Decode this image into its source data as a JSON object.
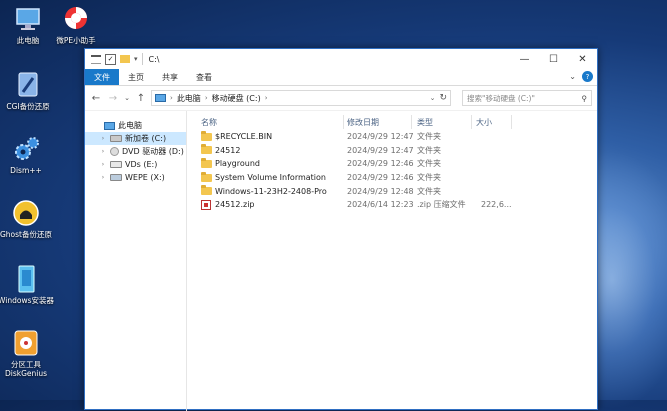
{
  "desktop": {
    "icons": [
      {
        "label": "此电脑"
      },
      {
        "label": "微PE小助手"
      },
      {
        "label": "CGI备份还原"
      },
      {
        "label": "Dism++"
      },
      {
        "label": "Ghost备份还原"
      },
      {
        "label": "Windows安装器"
      },
      {
        "label": "分区工具DiskGenius"
      }
    ]
  },
  "window": {
    "title": "C:\\",
    "controls": {
      "minimize": "—",
      "maximize": "☐",
      "close": "✕"
    },
    "ribbon_tabs": [
      "文件",
      "主页",
      "共享",
      "查看"
    ],
    "address": {
      "segments": [
        "此电脑",
        "移动硬盘 (C:)"
      ]
    },
    "search": {
      "placeholder": "搜索\"移动硬盘 (C:)\""
    },
    "nav": [
      {
        "label": "此电脑",
        "selected": false
      },
      {
        "label": "新加卷 (C:)",
        "selected": true
      },
      {
        "label": "DVD 驱动器 (D:) ",
        "selected": false
      },
      {
        "label": "VDs (E:)",
        "selected": false
      },
      {
        "label": "WEPE (X:)",
        "selected": false
      }
    ],
    "columns": {
      "name": "名称",
      "date": "修改日期",
      "type": "类型",
      "size": "大小"
    },
    "files": [
      {
        "name": "$RECYCLE.BIN",
        "date": "2024/9/29 12:47",
        "type": "文件夹",
        "size": "",
        "icon": "folder"
      },
      {
        "name": "24512",
        "date": "2024/9/29 12:47",
        "type": "文件夹",
        "size": "",
        "icon": "folder"
      },
      {
        "name": "Playground",
        "date": "2024/9/29 12:46",
        "type": "文件夹",
        "size": "",
        "icon": "folder"
      },
      {
        "name": "System Volume Information",
        "date": "2024/9/29 12:46",
        "type": "文件夹",
        "size": "",
        "icon": "folder"
      },
      {
        "name": "Windows-11-23H2-2408-Pro",
        "date": "2024/9/29 12:48",
        "type": "文件夹",
        "size": "",
        "icon": "folder"
      },
      {
        "name": "24512.zip",
        "date": "2024/6/14 12:23",
        "type": ".zip 压缩文件",
        "size": "222,6...",
        "icon": "zip"
      }
    ]
  },
  "colors": {
    "accent": "#1979ca",
    "selection": "#cce8ff",
    "folder": "#f3c64f"
  }
}
